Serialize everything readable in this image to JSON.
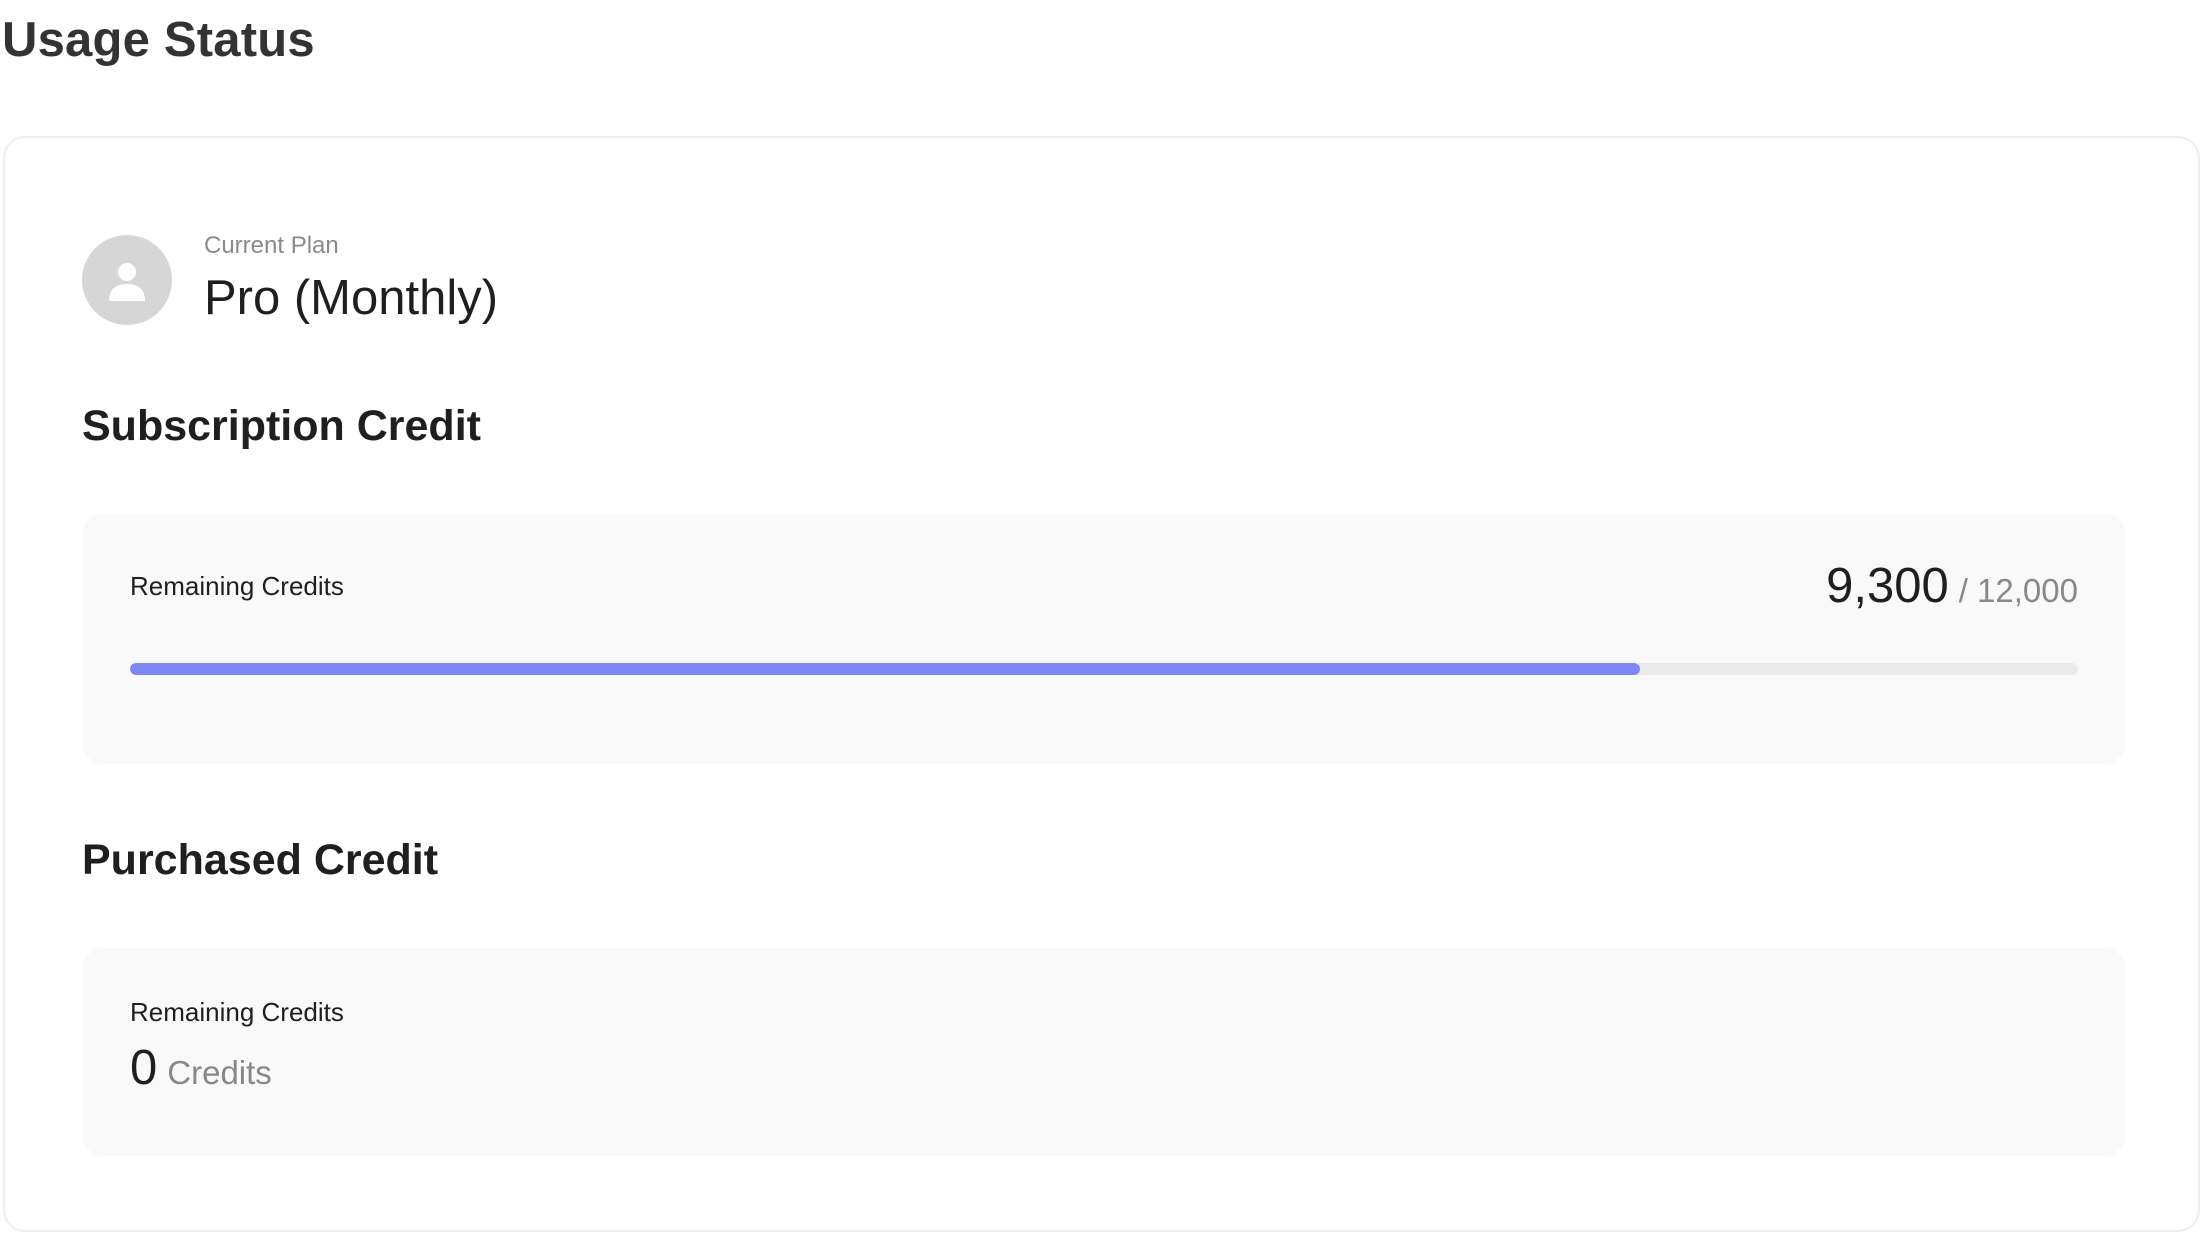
{
  "page": {
    "title": "Usage Status"
  },
  "plan": {
    "label": "Current Plan",
    "name": "Pro (Monthly)",
    "avatar_icon": "user-icon"
  },
  "subscription": {
    "heading": "Subscription Credit",
    "label": "Remaining Credits",
    "remaining": "9,300",
    "total": "/ 12,000",
    "remaining_value": 9300,
    "total_value": 12000,
    "progress_fraction": 0.775
  },
  "purchased": {
    "heading": "Purchased Credit",
    "label": "Remaining Credits",
    "value": "0",
    "unit": "Credits"
  },
  "colors": {
    "progress_fill": "#7f86f5",
    "progress_track": "#ebebeb",
    "panel_bg": "#f9f9f9",
    "avatar_bg": "#d6d6d6"
  }
}
